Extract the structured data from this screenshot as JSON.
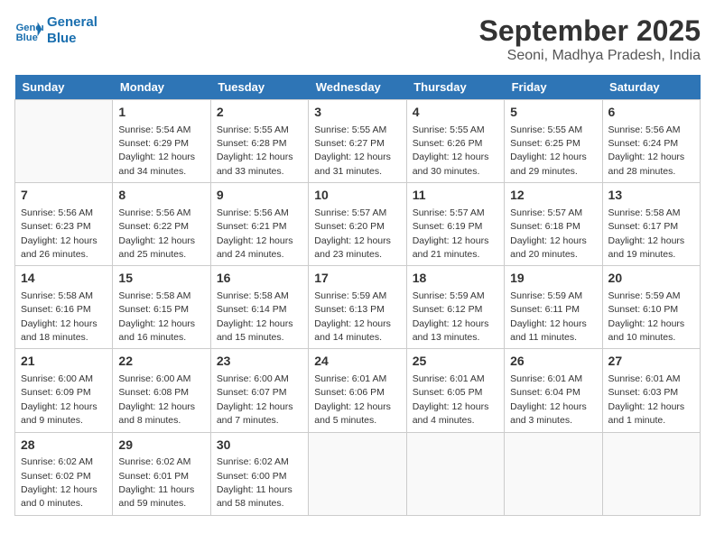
{
  "header": {
    "logo_line1": "General",
    "logo_line2": "Blue",
    "month": "September 2025",
    "location": "Seoni, Madhya Pradesh, India"
  },
  "days_of_week": [
    "Sunday",
    "Monday",
    "Tuesday",
    "Wednesday",
    "Thursday",
    "Friday",
    "Saturday"
  ],
  "weeks": [
    [
      {
        "day": "",
        "text": ""
      },
      {
        "day": "1",
        "text": "Sunrise: 5:54 AM\nSunset: 6:29 PM\nDaylight: 12 hours\nand 34 minutes."
      },
      {
        "day": "2",
        "text": "Sunrise: 5:55 AM\nSunset: 6:28 PM\nDaylight: 12 hours\nand 33 minutes."
      },
      {
        "day": "3",
        "text": "Sunrise: 5:55 AM\nSunset: 6:27 PM\nDaylight: 12 hours\nand 31 minutes."
      },
      {
        "day": "4",
        "text": "Sunrise: 5:55 AM\nSunset: 6:26 PM\nDaylight: 12 hours\nand 30 minutes."
      },
      {
        "day": "5",
        "text": "Sunrise: 5:55 AM\nSunset: 6:25 PM\nDaylight: 12 hours\nand 29 minutes."
      },
      {
        "day": "6",
        "text": "Sunrise: 5:56 AM\nSunset: 6:24 PM\nDaylight: 12 hours\nand 28 minutes."
      }
    ],
    [
      {
        "day": "7",
        "text": "Sunrise: 5:56 AM\nSunset: 6:23 PM\nDaylight: 12 hours\nand 26 minutes."
      },
      {
        "day": "8",
        "text": "Sunrise: 5:56 AM\nSunset: 6:22 PM\nDaylight: 12 hours\nand 25 minutes."
      },
      {
        "day": "9",
        "text": "Sunrise: 5:56 AM\nSunset: 6:21 PM\nDaylight: 12 hours\nand 24 minutes."
      },
      {
        "day": "10",
        "text": "Sunrise: 5:57 AM\nSunset: 6:20 PM\nDaylight: 12 hours\nand 23 minutes."
      },
      {
        "day": "11",
        "text": "Sunrise: 5:57 AM\nSunset: 6:19 PM\nDaylight: 12 hours\nand 21 minutes."
      },
      {
        "day": "12",
        "text": "Sunrise: 5:57 AM\nSunset: 6:18 PM\nDaylight: 12 hours\nand 20 minutes."
      },
      {
        "day": "13",
        "text": "Sunrise: 5:58 AM\nSunset: 6:17 PM\nDaylight: 12 hours\nand 19 minutes."
      }
    ],
    [
      {
        "day": "14",
        "text": "Sunrise: 5:58 AM\nSunset: 6:16 PM\nDaylight: 12 hours\nand 18 minutes."
      },
      {
        "day": "15",
        "text": "Sunrise: 5:58 AM\nSunset: 6:15 PM\nDaylight: 12 hours\nand 16 minutes."
      },
      {
        "day": "16",
        "text": "Sunrise: 5:58 AM\nSunset: 6:14 PM\nDaylight: 12 hours\nand 15 minutes."
      },
      {
        "day": "17",
        "text": "Sunrise: 5:59 AM\nSunset: 6:13 PM\nDaylight: 12 hours\nand 14 minutes."
      },
      {
        "day": "18",
        "text": "Sunrise: 5:59 AM\nSunset: 6:12 PM\nDaylight: 12 hours\nand 13 minutes."
      },
      {
        "day": "19",
        "text": "Sunrise: 5:59 AM\nSunset: 6:11 PM\nDaylight: 12 hours\nand 11 minutes."
      },
      {
        "day": "20",
        "text": "Sunrise: 5:59 AM\nSunset: 6:10 PM\nDaylight: 12 hours\nand 10 minutes."
      }
    ],
    [
      {
        "day": "21",
        "text": "Sunrise: 6:00 AM\nSunset: 6:09 PM\nDaylight: 12 hours\nand 9 minutes."
      },
      {
        "day": "22",
        "text": "Sunrise: 6:00 AM\nSunset: 6:08 PM\nDaylight: 12 hours\nand 8 minutes."
      },
      {
        "day": "23",
        "text": "Sunrise: 6:00 AM\nSunset: 6:07 PM\nDaylight: 12 hours\nand 7 minutes."
      },
      {
        "day": "24",
        "text": "Sunrise: 6:01 AM\nSunset: 6:06 PM\nDaylight: 12 hours\nand 5 minutes."
      },
      {
        "day": "25",
        "text": "Sunrise: 6:01 AM\nSunset: 6:05 PM\nDaylight: 12 hours\nand 4 minutes."
      },
      {
        "day": "26",
        "text": "Sunrise: 6:01 AM\nSunset: 6:04 PM\nDaylight: 12 hours\nand 3 minutes."
      },
      {
        "day": "27",
        "text": "Sunrise: 6:01 AM\nSunset: 6:03 PM\nDaylight: 12 hours\nand 1 minute."
      }
    ],
    [
      {
        "day": "28",
        "text": "Sunrise: 6:02 AM\nSunset: 6:02 PM\nDaylight: 12 hours\nand 0 minutes."
      },
      {
        "day": "29",
        "text": "Sunrise: 6:02 AM\nSunset: 6:01 PM\nDaylight: 11 hours\nand 59 minutes."
      },
      {
        "day": "30",
        "text": "Sunrise: 6:02 AM\nSunset: 6:00 PM\nDaylight: 11 hours\nand 58 minutes."
      },
      {
        "day": "",
        "text": ""
      },
      {
        "day": "",
        "text": ""
      },
      {
        "day": "",
        "text": ""
      },
      {
        "day": "",
        "text": ""
      }
    ]
  ]
}
